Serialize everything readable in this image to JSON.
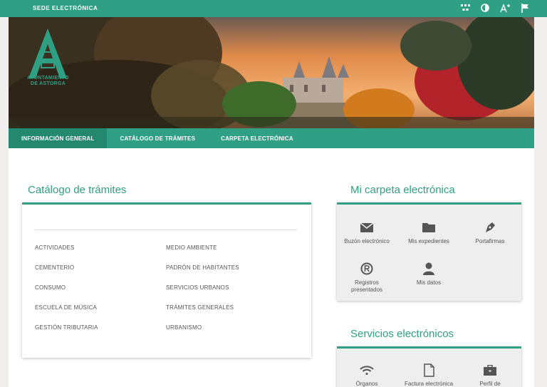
{
  "topbar": {
    "title": "SEDE ELECTRÓNICA",
    "icons": [
      "sitemap-icon",
      "contrast-icon",
      "font-size-icon",
      "flag-icon"
    ]
  },
  "logo": {
    "line1": "AYUNTAMIENTO",
    "line2": "DE ASTORGA"
  },
  "nav": {
    "tabs": [
      {
        "label": "INFORMACIÓN GENERAL",
        "active": true
      },
      {
        "label": "CATÁLOGO DE TRÁMITES",
        "active": false
      },
      {
        "label": "CARPETA ELECTRÓNICA",
        "active": false
      }
    ]
  },
  "catalogo": {
    "title": "Catálogo de trámites",
    "left": [
      "ACTIVIDADES",
      "CEMENTERIO",
      "CONSUMO",
      "ESCUELA DE MÚSICA",
      "GESTIÓN TRIBUTARIA"
    ],
    "right": [
      "MEDIO AMBIENTE",
      "PADRÓN DE HABITANTES",
      "SERVICIOS URBANOS",
      "TRÁMITES GENERALES",
      "URBANISMO"
    ]
  },
  "carpeta": {
    "title": "Mi carpeta electrónica",
    "items": [
      {
        "label": "Buzón electrónico",
        "icon": "envelope-icon"
      },
      {
        "label": "Mis expedientes",
        "icon": "folder-icon"
      },
      {
        "label": "Portafirmas",
        "icon": "pen-nib-icon"
      },
      {
        "label": "Registros presentados",
        "icon": "registered-icon"
      },
      {
        "label": "Mis datos",
        "icon": "user-icon"
      }
    ]
  },
  "servicios": {
    "title": "Servicios electrónicos",
    "items": [
      {
        "label": "Órganos",
        "icon": "wifi-icon"
      },
      {
        "label": "Factura electrónica",
        "icon": "document-icon"
      },
      {
        "label": "Perfil de",
        "icon": "briefcase-icon"
      }
    ]
  },
  "colors": {
    "accent": "#2fa083",
    "accent_dark": "#23886e",
    "card_gray": "#eeeeee"
  }
}
